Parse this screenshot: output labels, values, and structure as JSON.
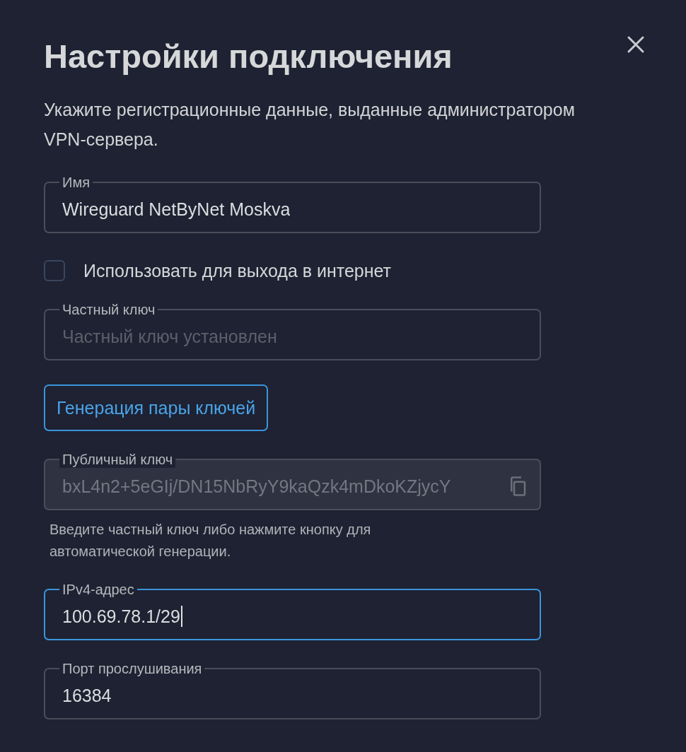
{
  "dialog": {
    "title": "Настройки подключения",
    "description": "Укажите регистрационные данные, выданные администратором VPN-сервера.",
    "items": [
      {
        "kind": "field",
        "label": "Имя",
        "value": "Wireguard NetByNet Moskva",
        "focused": false,
        "disabled": false
      },
      {
        "kind": "checkbox",
        "label": "Использовать для выхода в интернет",
        "checked": false
      },
      {
        "kind": "field",
        "label": "Частный ключ",
        "placeholder": "Частный ключ установлен",
        "focused": false,
        "disabled": false
      },
      {
        "kind": "button",
        "label": "Генерация пары ключей"
      },
      {
        "kind": "field",
        "label": "Публичный ключ",
        "value": "bxL4n2+5eGIj/DN15NbRyY9kaQzk4mDkoKZjycY",
        "focused": false,
        "disabled": true,
        "copyable": true
      },
      {
        "kind": "helper",
        "text": "Введите частный ключ либо нажмите кнопку для автоматической генерации."
      },
      {
        "kind": "field",
        "label": "IPv4-адрес",
        "value": "100.69.78.1/29",
        "focused": true,
        "disabled": false
      },
      {
        "kind": "field",
        "label": "Порт прослушивания",
        "value": "16384",
        "focused": false,
        "disabled": false
      }
    ]
  }
}
